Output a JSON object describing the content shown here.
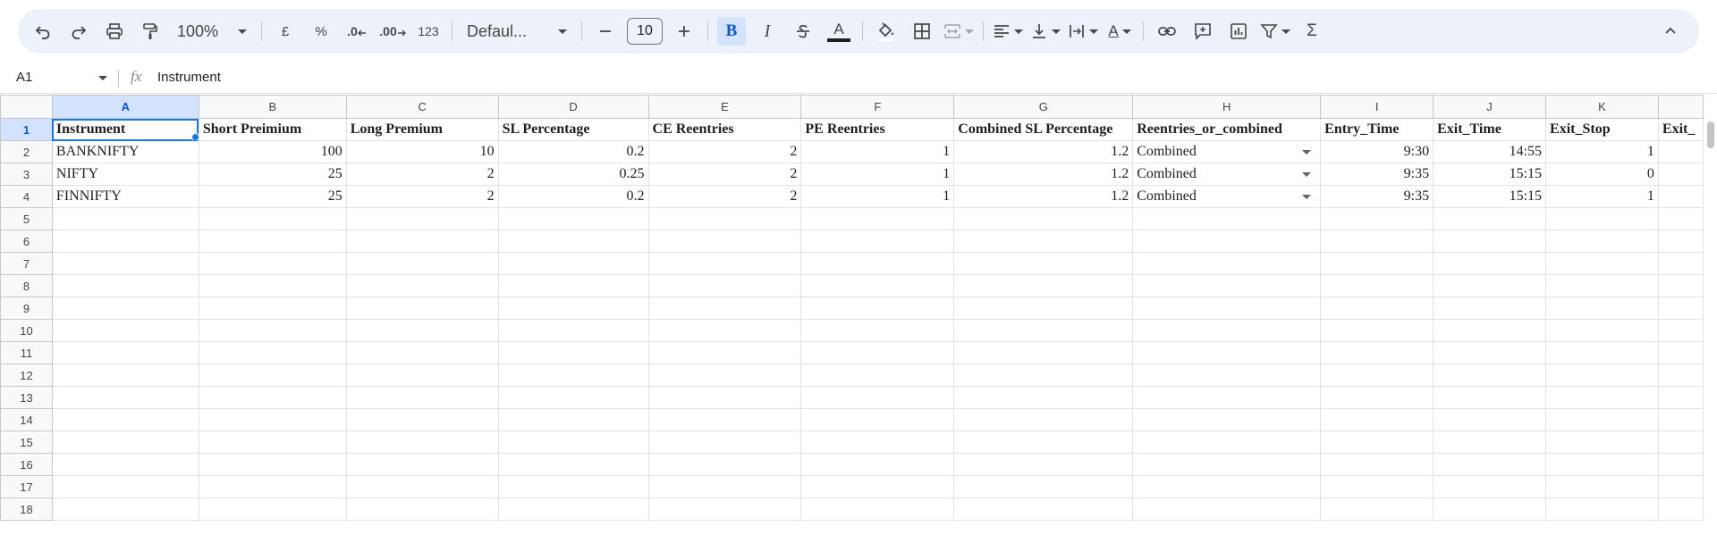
{
  "toolbar": {
    "zoom": "100%",
    "currency": "£",
    "percent": "%",
    "decrease_decimals": ".0",
    "increase_decimals": ".00",
    "number_format": "123",
    "font": "Defaul...",
    "font_size": "10",
    "bold": "B",
    "italic": "I",
    "text_color": "A",
    "text_rotation": "A",
    "sum": "Σ"
  },
  "formula_bar": {
    "cell_ref": "A1",
    "fx": "fx",
    "value": "Instrument"
  },
  "columns": [
    "A",
    "B",
    "C",
    "D",
    "E",
    "F",
    "G",
    "H",
    "I",
    "J",
    "K",
    ""
  ],
  "rows": [
    [
      "Instrument",
      "Short Preimium",
      "Long Premium",
      "SL Percentage",
      "CE Reentries",
      "PE Reentries",
      "Combined SL Percentage",
      "Reentries_or_combined",
      "Entry_Time",
      "Exit_Time",
      "Exit_Stop",
      "Exit_"
    ],
    [
      "BANKNIFTY",
      "100",
      "10",
      "0.2",
      "2",
      "1",
      "1.2",
      "Combined",
      "9:30",
      "14:55",
      "1",
      ""
    ],
    [
      "NIFTY",
      "25",
      "2",
      "0.25",
      "2",
      "1",
      "1.2",
      "Combined",
      "9:35",
      "15:15",
      "0",
      ""
    ],
    [
      "FINNIFTY",
      "25",
      "2",
      "0.2",
      "2",
      "1",
      "1.2",
      "Combined",
      "9:35",
      "15:15",
      "1",
      ""
    ]
  ],
  "row_numbers": [
    "1",
    "2",
    "3",
    "4",
    "5",
    "6",
    "7",
    "8",
    "9",
    "10",
    "11",
    "12",
    "13",
    "14",
    "15",
    "16",
    "17",
    "18"
  ],
  "colors": {
    "accent": "#1a73e8",
    "toolbar_bg": "#edf2fa",
    "selected_header": "#d3e3fd"
  }
}
